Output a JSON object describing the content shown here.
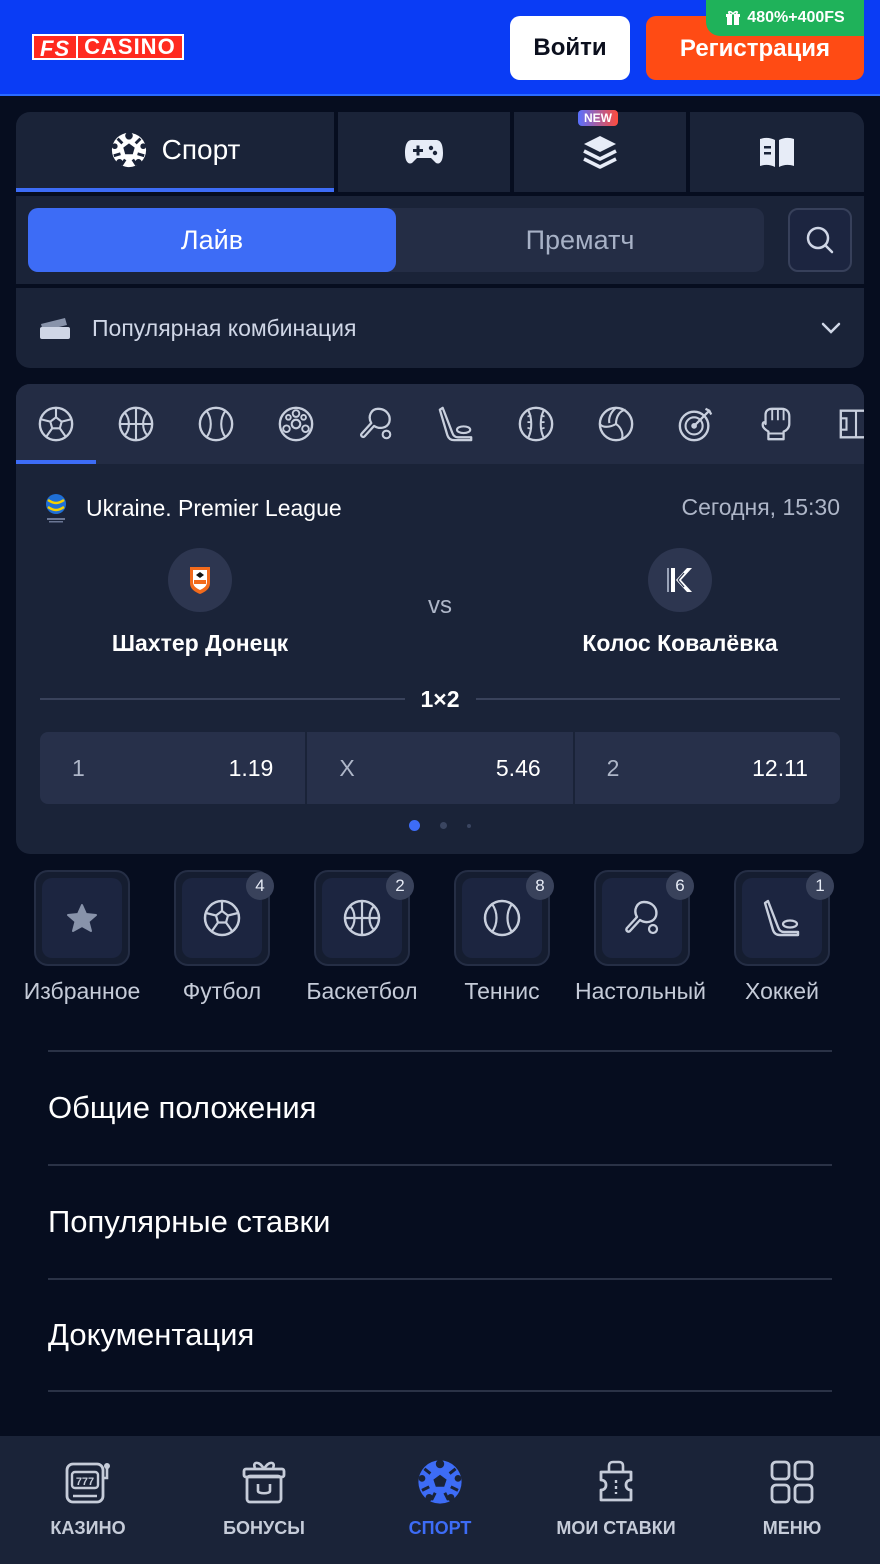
{
  "header": {
    "logo_fs": "FS",
    "logo_casino": "CASINO",
    "login_label": "Войти",
    "register_label": "Регистрация",
    "bonus_badge": "480%+400FS"
  },
  "top_tabs": {
    "sport_label": "Спорт",
    "new_badge": "NEW"
  },
  "mode": {
    "live_label": "Лайв",
    "prematch_label": "Прематч"
  },
  "combo": {
    "label": "Популярная комбинация"
  },
  "sport_icons": [
    "football-icon",
    "basketball-icon",
    "tennis-icon",
    "futsal-icon",
    "table-tennis-icon",
    "hockey-icon",
    "baseball-icon",
    "volleyball-icon",
    "darts-icon",
    "boxing-icon",
    "field-icon"
  ],
  "match": {
    "league": "Ukraine. Premier League",
    "time": "Сегодня, 15:30",
    "home_team": "Шахтер Донецк",
    "away_team": "Колос Ковалёвка",
    "vs": "vs",
    "market": "1×2",
    "odds": [
      {
        "key": "1",
        "value": "1.19"
      },
      {
        "key": "X",
        "value": "5.46"
      },
      {
        "key": "2",
        "value": "12.11"
      }
    ]
  },
  "categories": [
    {
      "label": "Избранное",
      "count": ""
    },
    {
      "label": "Футбол",
      "count": "4"
    },
    {
      "label": "Баскетбол",
      "count": "2"
    },
    {
      "label": "Теннис",
      "count": "8"
    },
    {
      "label": "Настольный теннис",
      "count": "6"
    },
    {
      "label": "Хоккей",
      "count": "1"
    }
  ],
  "footer_links": [
    "Общие положения",
    "Популярные ставки",
    "Документация"
  ],
  "bottom_nav": [
    {
      "label": "КАЗИНО",
      "icon": "slot-machine-icon"
    },
    {
      "label": "БОНУСЫ",
      "icon": "gift-icon"
    },
    {
      "label": "СПОРТ",
      "icon": "football-icon"
    },
    {
      "label": "МОИ СТАВКИ",
      "icon": "ticket-icon"
    },
    {
      "label": "МЕНЮ",
      "icon": "grid-icon"
    }
  ],
  "colors": {
    "header_bg": "#0a3cf5",
    "accent": "#3d6cf6",
    "register": "#ff4b14",
    "bonus": "#1fb25a",
    "panel": "#1a2338",
    "page_bg": "#060d1f"
  }
}
